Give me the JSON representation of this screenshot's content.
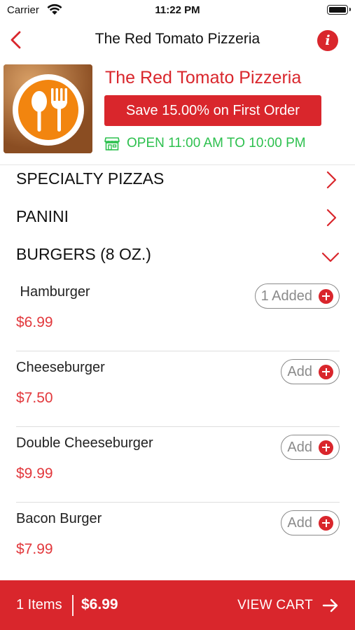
{
  "status_bar": {
    "carrier": "Carrier",
    "time": "11:22 PM"
  },
  "nav": {
    "title": "The Red Tomato Pizzeria",
    "info_glyph": "i"
  },
  "restaurant": {
    "name": "The Red Tomato Pizzeria",
    "offer": "Save 15.00% on First Order",
    "hours": "OPEN 11:00 AM TO 10:00 PM"
  },
  "categories": [
    {
      "label": "SPECIALTY PIZZAS",
      "state": "collapsed"
    },
    {
      "label": "PANINI",
      "state": "collapsed"
    },
    {
      "label": "BURGERS (8 OZ.)",
      "state": "expanded"
    }
  ],
  "items": [
    {
      "name": " Hamburger",
      "price": "$6.99",
      "button": "1 Added"
    },
    {
      "name": "Cheeseburger",
      "price": "$7.50",
      "button": "Add"
    },
    {
      "name": "Double Cheeseburger",
      "price": "$9.99",
      "button": "Add"
    },
    {
      "name": "Bacon Burger",
      "price": "$7.99",
      "button": "Add"
    }
  ],
  "cart": {
    "items": "1 Items",
    "total": "$6.99",
    "view_cart": "VIEW CART"
  },
  "colors": {
    "accent": "#d9262c",
    "price": "#e2383c",
    "open_green": "#2dc04e",
    "logo_orange": "#f2850f"
  },
  "icons": {
    "back": "chevron-left-icon",
    "info": "info-icon",
    "store": "store-icon",
    "collapsed": "chevron-right-icon",
    "expanded": "chevron-down-icon",
    "add": "plus-circle-icon",
    "cart_arrow": "arrow-right-icon"
  }
}
